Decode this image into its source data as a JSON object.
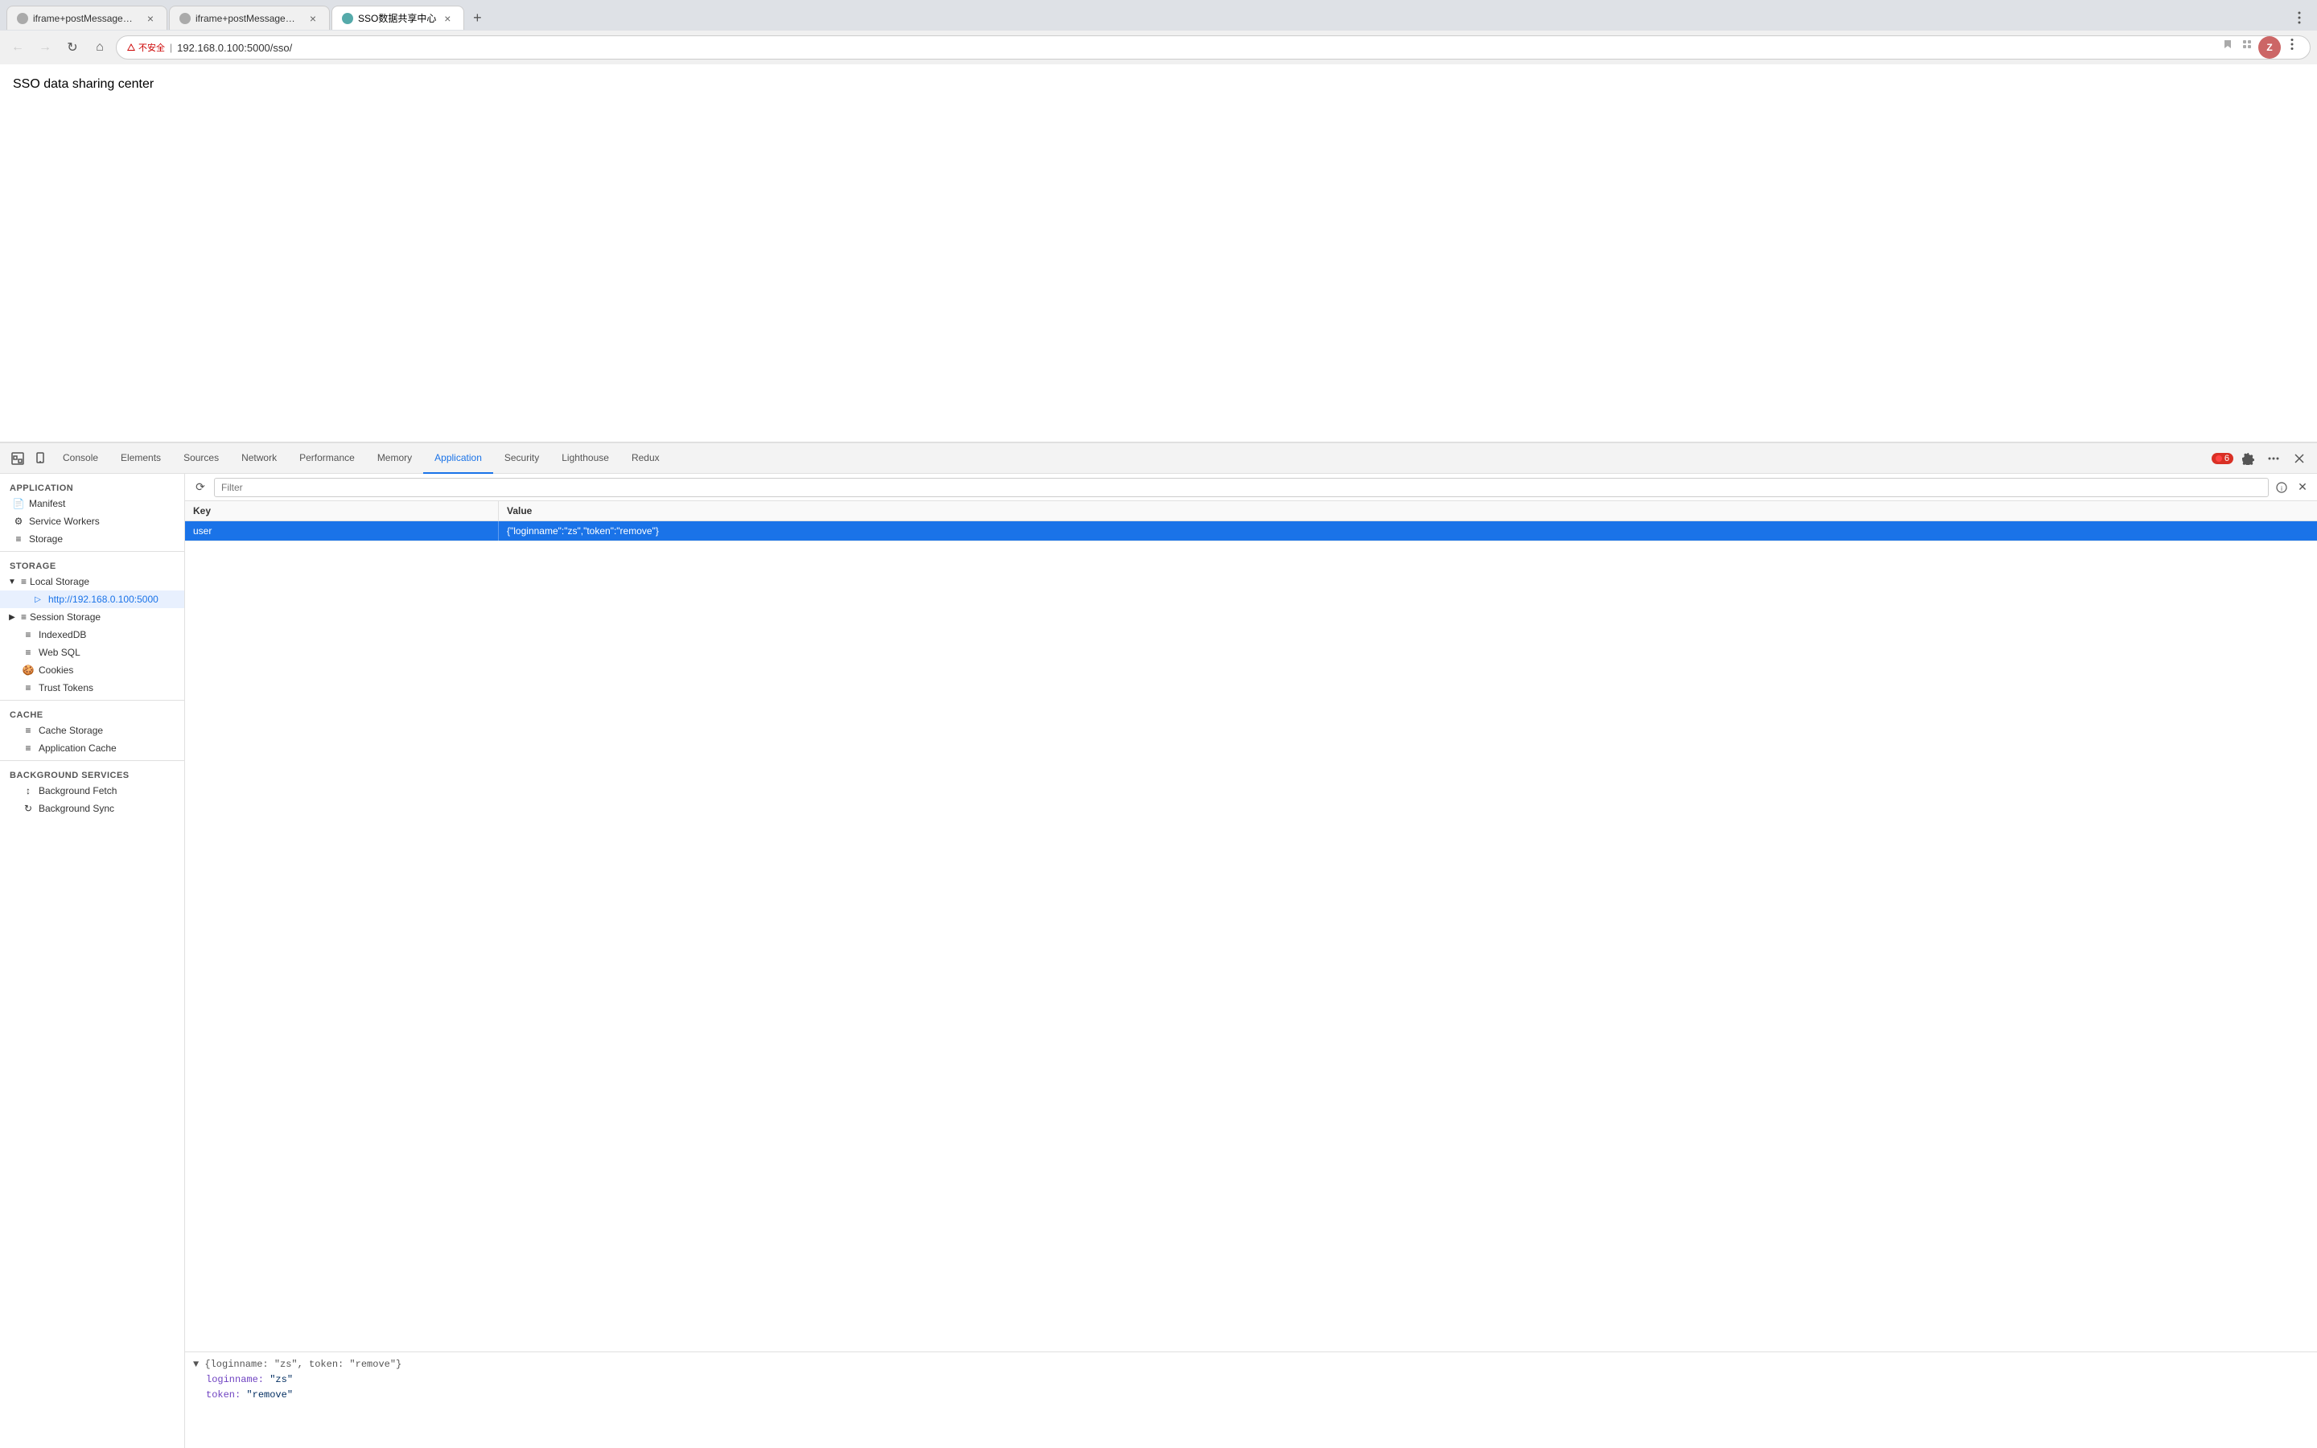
{
  "tabs": [
    {
      "id": "tab1",
      "title": "iframe+postMessage跨域通信...",
      "active": false,
      "favicon_color": "#aaa"
    },
    {
      "id": "tab2",
      "title": "iframe+postMessage跨域通信...",
      "active": false,
      "favicon_color": "#aaa"
    },
    {
      "id": "tab3",
      "title": "SSO数据共享中心",
      "active": true,
      "favicon_color": "#5aa"
    }
  ],
  "address_bar": {
    "security_label": "不安全",
    "url": "192.168.0.100:5000/sso/"
  },
  "page": {
    "title": "SSO data sharing center"
  },
  "devtools": {
    "tabs": [
      {
        "id": "console",
        "label": "Console"
      },
      {
        "id": "elements",
        "label": "Elements"
      },
      {
        "id": "sources",
        "label": "Sources"
      },
      {
        "id": "network",
        "label": "Network"
      },
      {
        "id": "performance",
        "label": "Performance"
      },
      {
        "id": "memory",
        "label": "Memory"
      },
      {
        "id": "application",
        "label": "Application",
        "active": true
      },
      {
        "id": "security",
        "label": "Security"
      },
      {
        "id": "lighthouse",
        "label": "Lighthouse"
      },
      {
        "id": "redux",
        "label": "Redux"
      }
    ],
    "error_count": "6"
  },
  "sidebar": {
    "application_label": "Application",
    "items_application": [
      {
        "id": "manifest",
        "label": "Manifest",
        "icon": "📄",
        "indent": 0
      },
      {
        "id": "service-workers",
        "label": "Service Workers",
        "icon": "⚙",
        "indent": 0
      },
      {
        "id": "storage",
        "label": "Storage",
        "icon": "≡",
        "indent": 0
      }
    ],
    "storage_label": "Storage",
    "items_storage": [
      {
        "id": "local-storage",
        "label": "Local Storage",
        "icon": "≡",
        "indent": 0,
        "expanded": true
      },
      {
        "id": "local-storage-url",
        "label": "http://192.168.0.100:5000",
        "icon": "",
        "indent": 1,
        "active": true
      },
      {
        "id": "session-storage",
        "label": "Session Storage",
        "icon": "≡",
        "indent": 0,
        "expanded": false
      },
      {
        "id": "indexeddb",
        "label": "IndexedDB",
        "icon": "≡",
        "indent": 0
      },
      {
        "id": "web-sql",
        "label": "Web SQL",
        "icon": "≡",
        "indent": 0
      },
      {
        "id": "cookies",
        "label": "Cookies",
        "icon": "🍪",
        "indent": 0
      },
      {
        "id": "trust-tokens",
        "label": "Trust Tokens",
        "icon": "≡",
        "indent": 0
      }
    ],
    "cache_label": "Cache",
    "items_cache": [
      {
        "id": "cache-storage",
        "label": "Cache Storage",
        "icon": "≡",
        "indent": 0
      },
      {
        "id": "app-cache",
        "label": "Application Cache",
        "icon": "≡",
        "indent": 0
      }
    ],
    "bg_services_label": "Background Services",
    "items_bg": [
      {
        "id": "bg-fetch",
        "label": "Background Fetch",
        "icon": "↕",
        "indent": 0
      },
      {
        "id": "bg-sync",
        "label": "Background Sync",
        "icon": "↻",
        "indent": 0
      }
    ]
  },
  "filter": {
    "placeholder": "Filter",
    "value": ""
  },
  "table": {
    "col_key": "Key",
    "col_value": "Value",
    "rows": [
      {
        "key": "user",
        "value": "{\"loginname\":\"zs\",\"token\":\"remove\"}",
        "selected": true
      }
    ]
  },
  "preview": {
    "collapse_text": "▼ {loginname: \"zs\", token: \"remove\"}",
    "line1_key": "loginname:",
    "line1_value": "\"zs\"",
    "line2_key": "token:",
    "line2_value": "\"remove\""
  }
}
